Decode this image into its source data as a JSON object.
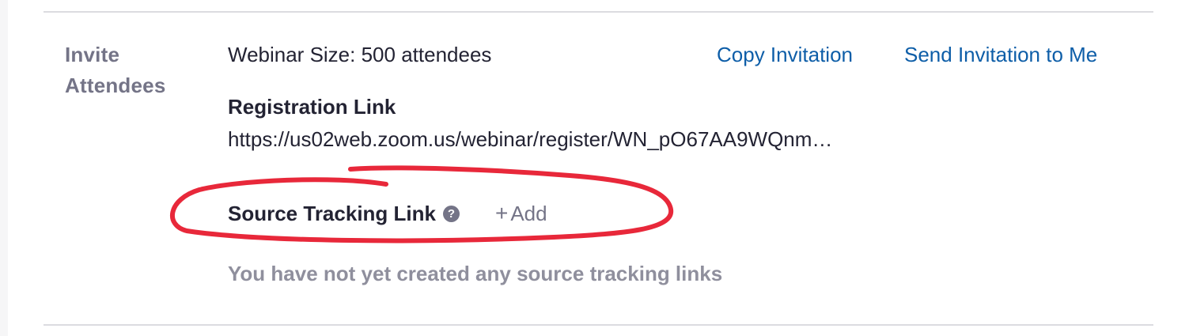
{
  "section": {
    "label_line1": "Invite",
    "label_line2": "Attendees"
  },
  "webinar": {
    "size_text": "Webinar Size: 500 attendees"
  },
  "actions": {
    "copy_invitation": "Copy Invitation",
    "send_invitation": "Send Invitation to Me"
  },
  "registration": {
    "heading": "Registration Link",
    "url": "https://us02web.zoom.us/webinar/register/WN_pO67AA9WQnm…"
  },
  "source_tracking": {
    "heading": "Source Tracking Link",
    "help_icon_name": "question-circle-icon",
    "help_glyph": "?",
    "add_icon_name": "plus-icon",
    "add_glyph": "+",
    "add_label": "Add",
    "empty_message": "You have not yet created any source tracking links"
  },
  "colors": {
    "link_blue": "#0e5ea8",
    "label_gray": "#747487",
    "text_dark": "#232333",
    "annotation_red": "#e8283a"
  }
}
